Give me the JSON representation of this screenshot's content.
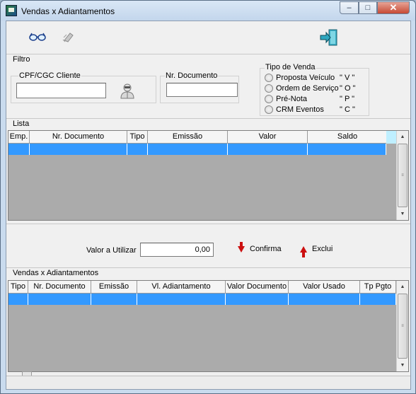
{
  "window": {
    "title": "Vendas x  Adiantamentos",
    "buttons": {
      "minimize": "–",
      "maximize": "□",
      "close": "✕"
    }
  },
  "toolbar": {
    "icons": [
      "glasses-icon",
      "eraser-icon",
      "exit-door-icon"
    ]
  },
  "filter": {
    "label": "Filtro",
    "cpf_label": "CPF/CGC Cliente",
    "cpf_value": "",
    "doc_label": "Nr. Documento",
    "doc_value": "",
    "tipo_venda": {
      "label": "Tipo de Venda",
      "options": [
        {
          "label": "Proposta Veículo",
          "code": "\" V \""
        },
        {
          "label": "Ordem de Serviço",
          "code": "\" O \""
        },
        {
          "label": "Pré-Nota",
          "code": "\" P \""
        },
        {
          "label": "CRM Eventos",
          "code": "\" C \""
        }
      ]
    }
  },
  "lista": {
    "label": "Lista",
    "columns": [
      "Emp.",
      "Nr. Documento",
      "Tipo",
      "Emissão",
      "Valor",
      "Saldo"
    ]
  },
  "valor": {
    "label": "Valor a Utilizar",
    "value": "0,00",
    "confirma": "Confirma",
    "exclui": "Exclui"
  },
  "vendas": {
    "label": "Vendas  x  Adiantamentos",
    "columns": [
      "Tipo",
      "Nr. Documento",
      "Emissão",
      "Vl. Adiantamento",
      "Valor Documento",
      "Valor Usado",
      "Tp Pgto"
    ]
  },
  "colors": {
    "selection": "#3399ff",
    "grid_bg": "#ababab",
    "arrow": "#cc1010"
  }
}
